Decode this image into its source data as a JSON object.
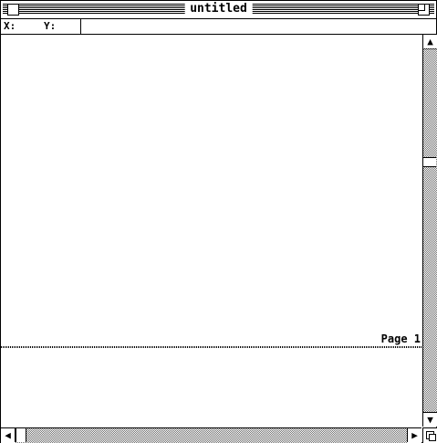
{
  "window": {
    "title": "untitled"
  },
  "coords": {
    "x_label": "X:",
    "y_label": "Y:",
    "x_value": "",
    "y_value": ""
  },
  "canvas": {
    "page_label": "Page 1"
  },
  "icons": {
    "scroll_up": "▲",
    "scroll_down": "▼",
    "scroll_left": "◀",
    "scroll_right": "▶"
  }
}
